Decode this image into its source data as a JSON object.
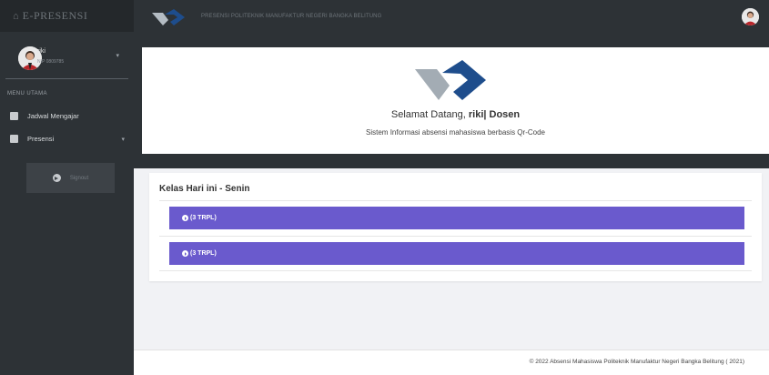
{
  "sidebar": {
    "brand_text": "E-PRESENSI",
    "home_icon": "home-icon",
    "user": {
      "name": "riki",
      "nip": "NIP 0809785"
    },
    "menu_heading": "MENU UTAMA",
    "items": [
      {
        "label": "Jadwal Mengajar",
        "icon": "calendar-check-icon"
      },
      {
        "label": "Presensi",
        "icon": "clipboard-icon"
      }
    ],
    "signout_label": "Signout"
  },
  "topbar": {
    "title": "PRESENSI POLITEKNIK MANUFAKTUR NEGERI BANGKA BELITUNG"
  },
  "welcome": {
    "greeting_prefix": "Selamat Datang,",
    "user_role": "riki| Dosen",
    "subtitle": "Sistem Informasi absensi mahasiswa berbasis Qr-Code"
  },
  "classes": {
    "title": "Kelas Hari ini - Senin",
    "items": [
      {
        "label": "(3 TRPL)"
      },
      {
        "label": "(3 TRPL)"
      }
    ]
  },
  "footer": {
    "text": "© 2022 Absensi Mahasiswa Politeknik Manufaktur Negeri Bangka Belitung ( 2021)"
  },
  "colors": {
    "sidebar_bg": "#2d3236",
    "class_button": "#6a5acd",
    "logo_blue": "#1e4d8c",
    "logo_gray": "#9aa3ab"
  }
}
